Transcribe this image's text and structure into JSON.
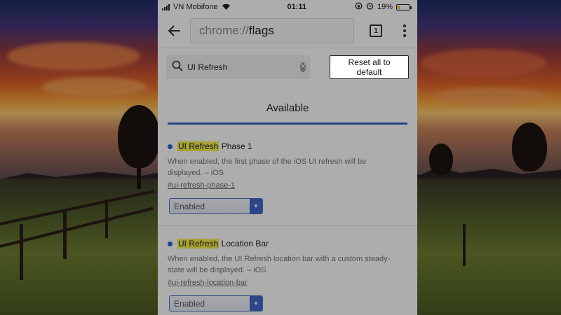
{
  "status_bar": {
    "carrier": "VN Mobifone",
    "time": "01:11",
    "battery": "19%",
    "battery_level": 0.19
  },
  "toolbar": {
    "url_scheme": "chrome://",
    "url_host": "flags",
    "tab_count": "1",
    "icons": [
      "back-arrow-icon",
      "tabs-icon",
      "more-menu-icon"
    ]
  },
  "search": {
    "value": "UI Refresh",
    "reset_label": "Reset all to default"
  },
  "tab": {
    "label": "Available"
  },
  "flags": [
    {
      "highlight": "UI Refresh",
      "title_rest": " Phase 1",
      "description": "When enabled, the first phase of the iOS UI refresh will be displayed. – iOS",
      "link": "#ui-refresh-phase-1",
      "value": "Enabled"
    },
    {
      "highlight": "UI Refresh",
      "title_rest": " Location Bar",
      "description": "When enabled, the UI Refresh location bar with a custom steady-state will be displayed. – iOS",
      "link": "#ui-refresh-location-bar",
      "value": "Enabled"
    }
  ],
  "colors": {
    "accent": "#3366cc",
    "highlight": "#f6ef4a"
  }
}
